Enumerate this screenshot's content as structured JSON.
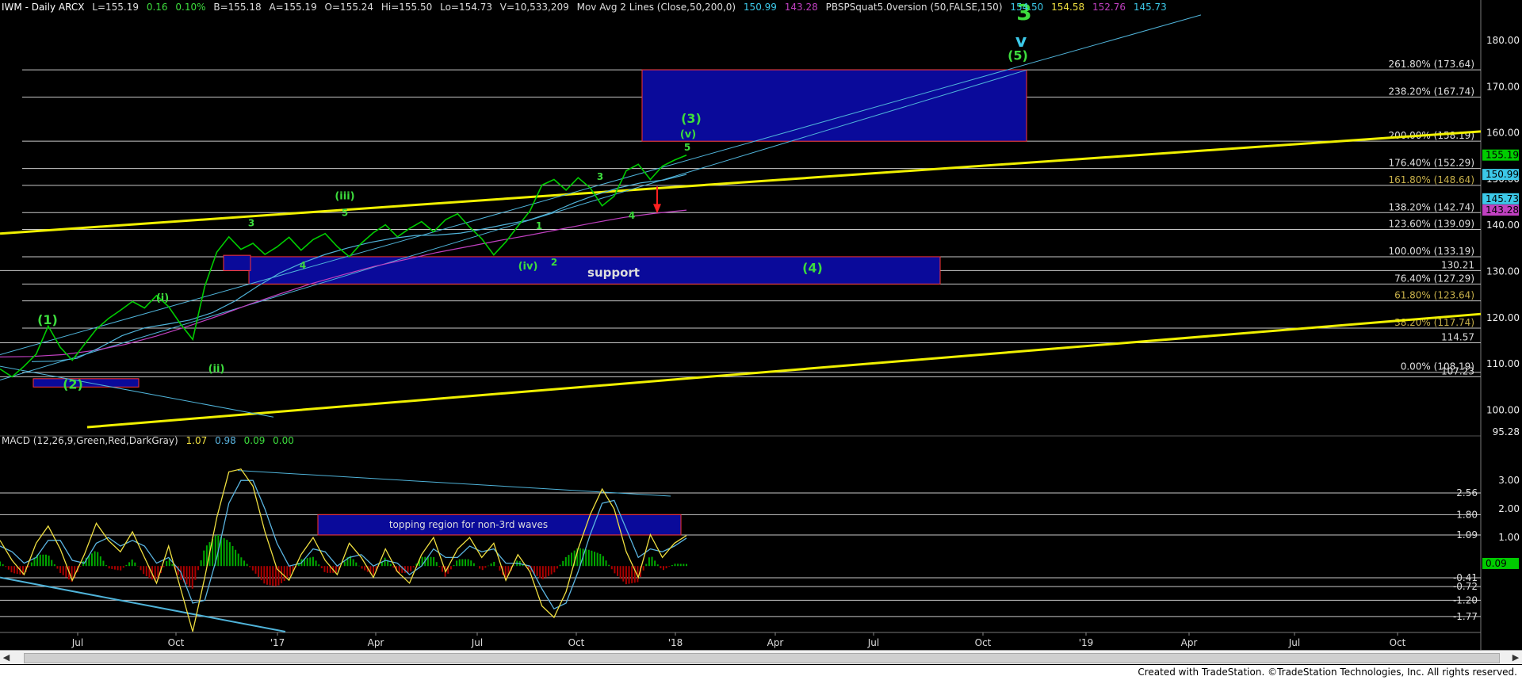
{
  "header": {
    "symbol": "IWM - Daily  ARCX",
    "last": "L=155.19",
    "change": "0.16",
    "change_pct": "0.10%",
    "bid": "B=155.18",
    "ask": "A=155.19",
    "open": "O=155.24",
    "high": "Hi=155.50",
    "low": "Lo=154.73",
    "volume": "V=10,533,209",
    "ma_study": "Mov Avg 2 Lines (Close,50,200,0)",
    "ma1": "150.99",
    "ma2": "143.28",
    "pbs_study": "PBSPSquat5.0version (50,FALSE,150)",
    "pbs1": "154.50",
    "pbs2": "154.58",
    "pbs3": "152.76",
    "pbs4": "145.73"
  },
  "macd_header": {
    "study": "MACD (12,26,9,Green,Red,DarkGray)",
    "v1": "1.07",
    "v2": "0.98",
    "v3": "0.09",
    "v4": "0.00"
  },
  "footer": {
    "text": "Created with TradeStation. ©TradeStation Technologies, Inc. All rights reserved."
  },
  "colors": {
    "background": "#000000",
    "price": "#00cc00",
    "trend_yellow": "#f0f000",
    "channel": "#4fb3d9",
    "ma200": "#c040c0",
    "box_fill": "#0a0a9a",
    "box_border": "#ff3333",
    "macd_fast": "#f0e040",
    "macd_signal": "#5ab4e0",
    "hist_up": "#00aa00",
    "hist_down": "#aa0000",
    "label_green": "#3ddc3d",
    "label_cyan": "#3cc8e8"
  },
  "chart_data": [
    {
      "type": "line",
      "panel": "price",
      "ylim": [
        95.28,
        186
      ],
      "y_ticks": [
        "180.00",
        "170.00",
        "160.00",
        "150.00",
        "140.00",
        "130.00",
        "120.00",
        "110.00",
        "100.00",
        "95.28"
      ],
      "x_ticks": [
        "Jul",
        "Oct",
        "'17",
        "Apr",
        "Jul",
        "Oct",
        "'18",
        "Apr",
        "Jul",
        "Oct",
        "'19",
        "Apr",
        "Jul",
        "Oct"
      ],
      "series": [
        {
          "values": [
            108.9,
            107.2,
            109.5,
            112.1,
            118.2,
            113.6,
            110.8,
            114.2,
            117.5,
            119.8,
            121.6,
            123.5,
            122.1,
            124.8,
            122.4,
            118.6,
            115.3,
            126.8,
            134.2,
            137.5,
            134.8,
            136.1,
            133.7,
            135.3,
            137.4,
            134.6,
            136.9,
            138.2,
            135.4,
            133.2,
            136.1,
            138.4,
            140.1,
            137.5,
            139.3,
            140.8,
            138.6,
            141.2,
            142.5,
            139.6,
            137.1,
            133.6,
            136.4,
            139.8,
            143.1,
            148.7,
            149.9,
            147.6,
            150.3,
            148.1,
            144.2,
            146.3,
            151.8,
            153.2,
            149.9,
            152.8,
            154.1,
            155.19
          ]
        }
      ],
      "moving_averages": [
        {
          "name": "50",
          "values": [
            110.5,
            110.6,
            111.2,
            113.5,
            116.1,
            117.8,
            118.6,
            119.5,
            121.1,
            123.6,
            126.8,
            129.7,
            131.9,
            133.7,
            135.1,
            136.3,
            137.2,
            137.8,
            137.9,
            138.3,
            139.2,
            140.2,
            141.1,
            142.7,
            144.8,
            146.6,
            148.1,
            149.2,
            149.8,
            150.99
          ]
        },
        {
          "name": "200",
          "values": [
            111.5,
            111.6,
            112.0,
            112.9,
            114.2,
            116.0,
            118.1,
            120.4,
            122.9,
            125.2,
            127.4,
            129.3,
            131.1,
            132.6,
            134.1,
            135.4,
            136.7,
            137.9,
            139.2,
            140.5,
            141.7,
            142.6,
            143.28
          ]
        }
      ],
      "support_text": "support",
      "wave_labels": [
        "(1)",
        "(2)",
        "(i)",
        "(ii)",
        "3",
        "4",
        "(iii)",
        "5",
        "(iv)",
        "1",
        "2",
        "3",
        "4",
        "5",
        "(v)",
        "(3)",
        "(4)",
        "(5)",
        "3",
        "v"
      ],
      "fib_labels": [
        {
          "label": "261.80% (173.64)",
          "value": 173.64
        },
        {
          "label": "238.20% (167.74)",
          "value": 167.74
        },
        {
          "label": "200.00% (158.19)",
          "value": 158.19
        },
        {
          "label": "176.40% (152.29)",
          "value": 152.29
        },
        {
          "label": "161.80% (148.64)",
          "value": 148.64
        },
        {
          "label": "138.20% (142.74)",
          "value": 142.74
        },
        {
          "label": "123.60% (139.09)",
          "value": 139.09
        },
        {
          "label": "100.00% (133.19)",
          "value": 133.19
        },
        {
          "label": "76.40% (127.29)",
          "value": 127.29
        },
        {
          "label": "61.80% (123.64)",
          "value": 123.64
        },
        {
          "label": "38.20% (117.74)",
          "value": 117.74
        },
        {
          "label": "0.00% (108.19)",
          "value": 108.19
        }
      ],
      "h_levels": [
        {
          "label": "130.21",
          "value": 130.21
        },
        {
          "label": "114.57",
          "value": 114.57
        },
        {
          "label": "107.23",
          "value": 107.23
        }
      ],
      "price_tags": [
        {
          "label": "155.19",
          "value": 155.19,
          "color": "#00cc00"
        },
        {
          "label": "150.99",
          "value": 150.99,
          "color": "#3cc8e8"
        },
        {
          "label": "145.73",
          "value": 145.73,
          "color": "#3cc8e8"
        },
        {
          "label": "143.28",
          "value": 143.28,
          "color": "#c040c0"
        }
      ]
    },
    {
      "type": "line",
      "panel": "macd",
      "ylim": [
        -2.3,
        4.2
      ],
      "y_ticks": [
        "3.00",
        "2.00",
        "1.00",
        "-1.20",
        "-1.77"
      ],
      "levels": [
        {
          "label": "2.56",
          "value": 2.56
        },
        {
          "label": "1.80",
          "value": 1.8
        },
        {
          "label": "1.09",
          "value": 1.09
        },
        {
          "label": "-0.41",
          "value": -0.41
        },
        {
          "label": "-0.72",
          "value": -0.72
        },
        {
          "label": "-1.20",
          "value": -1.2
        },
        {
          "label": "-1.77",
          "value": -1.77
        }
      ],
      "annotation": "topping region for non-3rd waves",
      "last_value_tag": "0.09",
      "series": [
        {
          "name": "MACD",
          "values": [
            0.9,
            0.2,
            -0.3,
            0.8,
            1.4,
            0.6,
            -0.5,
            0.4,
            1.5,
            0.9,
            0.5,
            1.2,
            0.3,
            -0.6,
            0.7,
            -0.8,
            -2.3,
            -0.4,
            1.7,
            3.3,
            3.4,
            2.8,
            1.2,
            -0.1,
            -0.5,
            0.4,
            1.0,
            0.2,
            -0.3,
            0.8,
            0.3,
            -0.4,
            0.6,
            -0.2,
            -0.6,
            0.4,
            1.0,
            -0.2,
            0.6,
            1.0,
            0.3,
            0.8,
            -0.5,
            0.4,
            -0.2,
            -1.4,
            -1.8,
            -0.9,
            0.6,
            1.8,
            2.7,
            2.0,
            0.5,
            -0.4,
            1.1,
            0.3,
            0.8,
            1.07
          ]
        },
        {
          "name": "Signal",
          "values": [
            0.7,
            0.5,
            0.1,
            0.3,
            0.9,
            0.9,
            0.2,
            0.1,
            0.8,
            1.0,
            0.7,
            0.9,
            0.7,
            0.1,
            0.3,
            -0.2,
            -1.3,
            -1.2,
            0.3,
            2.2,
            3.0,
            3.0,
            2.0,
            0.8,
            0.0,
            0.1,
            0.6,
            0.5,
            0.0,
            0.3,
            0.4,
            0.0,
            0.2,
            0.1,
            -0.3,
            0.0,
            0.6,
            0.3,
            0.3,
            0.7,
            0.5,
            0.6,
            0.1,
            0.1,
            0.0,
            -0.8,
            -1.5,
            -1.3,
            -0.2,
            1.1,
            2.2,
            2.3,
            1.3,
            0.3,
            0.6,
            0.5,
            0.7,
            0.98
          ]
        }
      ]
    }
  ]
}
